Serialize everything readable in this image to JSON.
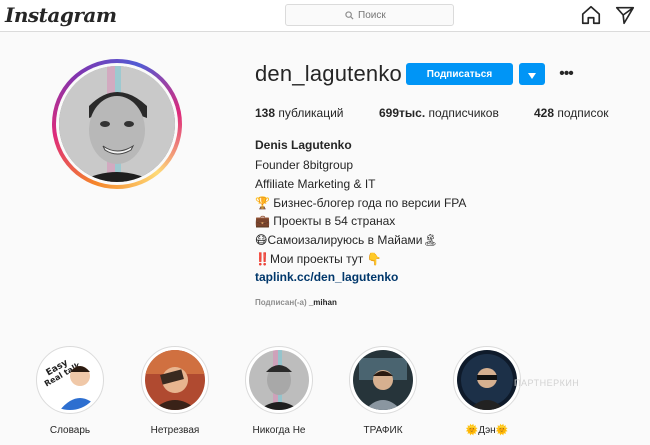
{
  "app": {
    "logo_text": "Instagram"
  },
  "search": {
    "placeholder": "Поиск"
  },
  "profile": {
    "username": "den_lagutenko",
    "follow_label": "Подписаться",
    "more_label": "•••",
    "stats": {
      "posts_count": "138",
      "posts_label": " публикаций",
      "followers_count": "699тыс.",
      "followers_label": " подписчиков",
      "following_count": "428",
      "following_label": " подписок"
    },
    "bio": {
      "name": "Denis Lagutenko",
      "line1": "Founder 8bitgroup",
      "line2": "Affiliate Marketing & IT",
      "line3": "🏆 Бизнес-блогер года по версии FPA",
      "line4": "💼 Проекты в 54 странах",
      "line5": "😷Самоизалируюсь в Майами🏝",
      "line6": "‼️Мои проекты тут 👇",
      "link": "taplink.cc/den_lagutenko"
    },
    "followed_by_prefix": "Подписан(-а) ",
    "followed_by_name": "_mihan"
  },
  "highlights": [
    {
      "label": "Словарь"
    },
    {
      "label": "Нетрезвая"
    },
    {
      "label": "Никогда Не"
    },
    {
      "label": "ТРАФИК"
    },
    {
      "label": "🌞Дэн🌞"
    }
  ],
  "watermark": "ПАРТНЕРКИН",
  "colors": {
    "accent": "#0095f6",
    "link": "#00376b",
    "secondary_text": "#8e8e8e"
  }
}
